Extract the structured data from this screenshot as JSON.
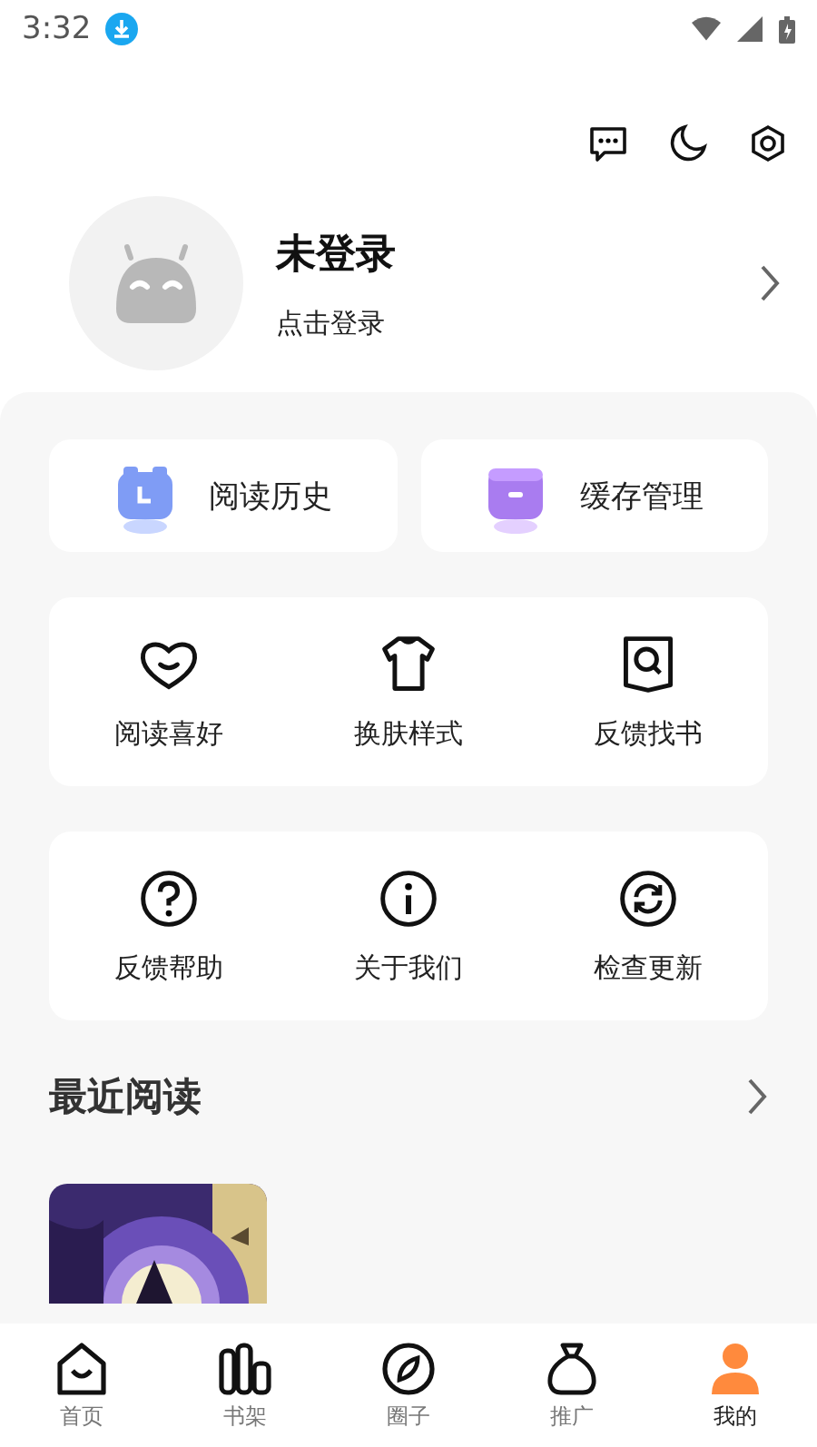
{
  "status_bar": {
    "time": "3:32"
  },
  "profile": {
    "name": "未登录",
    "hint": "点击登录"
  },
  "quick": [
    {
      "kind": "history",
      "label": "阅读历史"
    },
    {
      "kind": "cache",
      "label": "缓存管理"
    }
  ],
  "groups": [
    [
      {
        "kind": "heart",
        "label": "阅读喜好"
      },
      {
        "kind": "shirt",
        "label": "换肤样式"
      },
      {
        "kind": "search",
        "label": "反馈找书"
      }
    ],
    [
      {
        "kind": "help",
        "label": "反馈帮助"
      },
      {
        "kind": "info",
        "label": "关于我们"
      },
      {
        "kind": "refresh",
        "label": "检查更新"
      }
    ]
  ],
  "recent": {
    "title": "最近阅读"
  },
  "tabs": [
    {
      "kind": "home",
      "label": "首页",
      "selected": false
    },
    {
      "kind": "shelf",
      "label": "书架",
      "selected": false
    },
    {
      "kind": "compass",
      "label": "圈子",
      "selected": false
    },
    {
      "kind": "bag",
      "label": "推广",
      "selected": false
    },
    {
      "kind": "person",
      "label": "我的",
      "selected": true
    }
  ]
}
